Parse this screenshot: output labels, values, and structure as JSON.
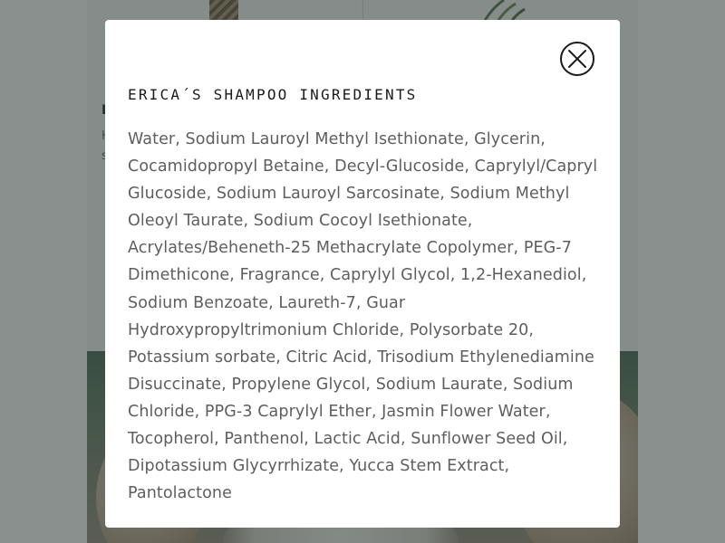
{
  "background_page": {
    "left_card": {
      "title": "L",
      "text_lines": [
        "H",
        "s"
      ]
    }
  },
  "modal": {
    "title": "ERICA´S SHAMPOO INGREDIENTS",
    "close_icon": "close-x-circle-icon",
    "ingredients": "Water, Sodium Lauroyl Methyl Isethionate, Glycerin, Cocamidopropyl Betaine, Decyl-Glucoside, Caprylyl/Capryl Glucoside, Sodium Lauroyl Sarcosinate, Sodium Methyl Oleoyl Taurate, Sodium Cocoyl Isethionate, Acrylates/Beheneth-25 Methacrylate Copolymer, PEG-7 Dimethicone, Fragrance, Caprylyl Glycol, 1,2-Hexanediol, Sodium Benzoate, Laureth-7, Guar Hydroxypropyltrimonium Chloride, Polysorbate 20, Potassium sorbate, Citric Acid, Trisodium Ethylenediamine Disuccinate, Propylene Glycol, Sodium Laurate, Sodium Chloride, PPG-3 Caprylyl Ether, Jasmin Flower Water, Tocopherol, Panthenol, Lactic Acid, Sunflower Seed Oil, Dipotassium Glycyrrhizate, Yucca Stem Extract, Pantolactone"
  },
  "colors": {
    "overlay": "#283430",
    "modal_background": "#ffffff",
    "title_text": "#1a1a1a",
    "body_text": "#5e5e5e"
  }
}
